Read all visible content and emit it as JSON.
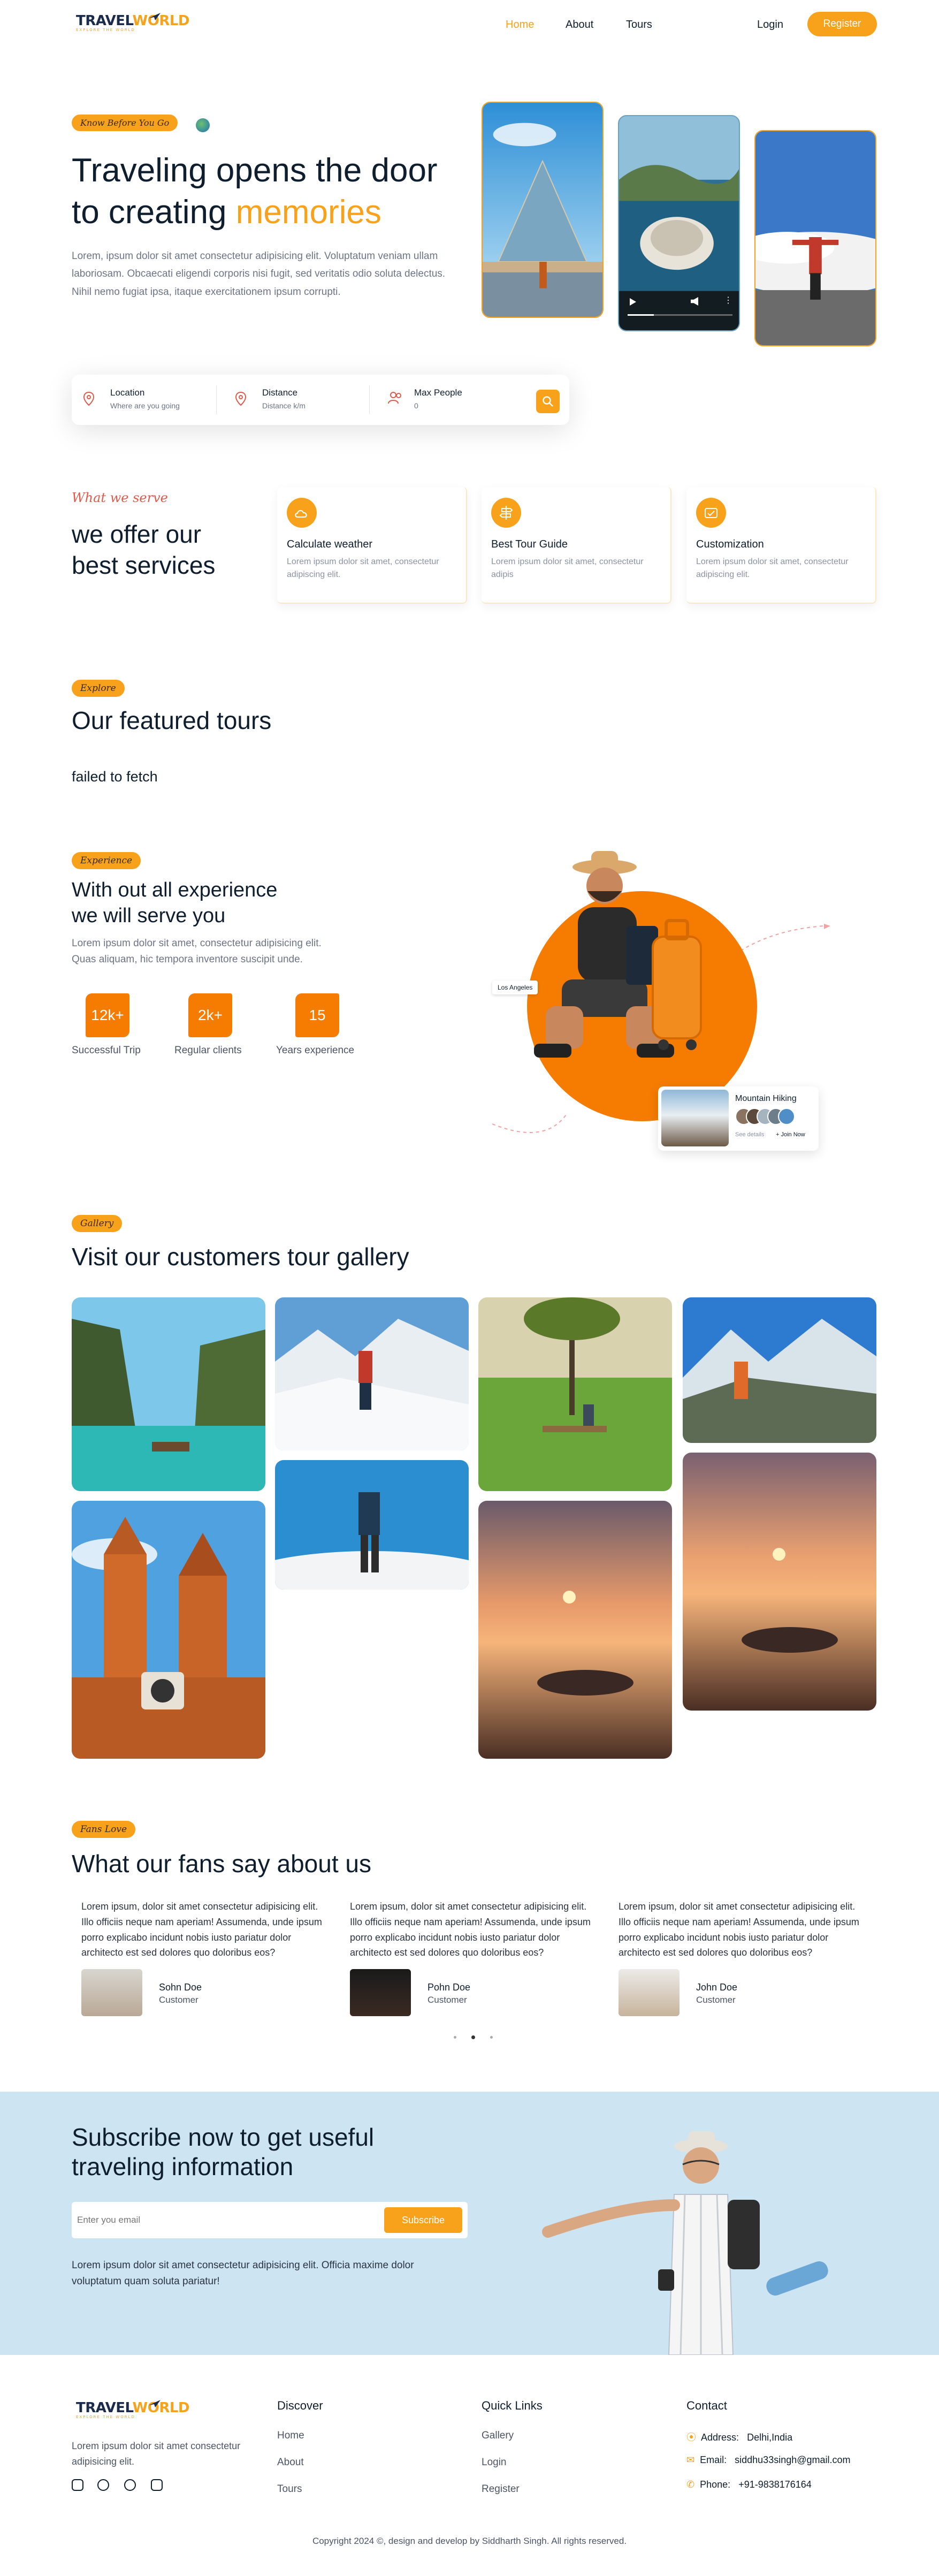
{
  "nav": {
    "logo_part1": "TRAVEL",
    "logo_part2": "WORLD",
    "logo_tagline": "EXPLORE THE WORLD",
    "links": [
      "Home",
      "About",
      "Tours"
    ],
    "login": "Login",
    "register": "Register"
  },
  "hero": {
    "pill": "Know Before You Go",
    "title_line1": "Traveling opens the door",
    "title_line2_prefix": "to creating ",
    "title_highlight": "memories",
    "paragraph": "Lorem, ipsum dolor sit amet consectetur adipisicing elit. Voluptatum veniam ullam laboriosam. Obcaecati eligendi corporis nisi fugit, sed veritatis odio soluta delectus. Nihil nemo fugiat ipsa, itaque exercitationem ipsum corrupti."
  },
  "search": {
    "fields": [
      {
        "label": "Location",
        "placeholder": "Where are you going",
        "icon": "location-pin-icon"
      },
      {
        "label": "Distance",
        "placeholder": "Distance k/m",
        "icon": "location-pin-icon"
      },
      {
        "label": "Max People",
        "placeholder": "0",
        "icon": "people-icon"
      }
    ]
  },
  "services": {
    "pill": "What we serve",
    "title_line1": "we offer our",
    "title_line2": "best services",
    "cards": [
      {
        "title": "Calculate weather",
        "desc": "Lorem ipsum dolor sit amet, consectetur adipiscing elit.",
        "icon": "weather-icon"
      },
      {
        "title": "Best Tour Guide",
        "desc": "Lorem ipsum dolor sit amet, consectetur adipis",
        "icon": "guide-icon"
      },
      {
        "title": "Customization",
        "desc": "Lorem ipsum dolor sit amet, consectetur adipiscing elit.",
        "icon": "customization-icon"
      }
    ]
  },
  "featured": {
    "pill": "Explore",
    "title": "Our featured tours",
    "status": "failed to fetch"
  },
  "experience": {
    "pill": "Experience",
    "title_line1": "With out all experience",
    "title_line2": "we will serve you",
    "paragraph_line1": "Lorem ipsum dolor sit amet, consectetur adipisicing elit.",
    "paragraph_line2": "Quas aliquam, hic tempora inventore suscipit unde.",
    "stats": [
      {
        "value": "12k+",
        "label": "Successful Trip"
      },
      {
        "value": "2k+",
        "label": "Regular clients"
      },
      {
        "value": "15",
        "label": "Years experience"
      }
    ],
    "location_tag": "Los Angeles",
    "card_title": "Mountain Hiking",
    "card_details": "See details",
    "card_join": "+ Join Now"
  },
  "gallery": {
    "pill": "Gallery",
    "title": "Visit our customers tour gallery"
  },
  "fans": {
    "pill": "Fans Love",
    "title": "What our fans say about us",
    "items": [
      {
        "text": "Lorem ipsum, dolor sit amet consectetur adipisicing elit. Illo officiis neque nam aperiam! Assumenda, unde ipsum porro explicabo incidunt nobis iusto pariatur dolor architecto est sed dolores quo doloribus eos?",
        "name": "Sohn Doe",
        "role": "Customer"
      },
      {
        "text": "Lorem ipsum, dolor sit amet consectetur adipisicing elit. Illo officiis neque nam aperiam! Assumenda, unde ipsum porro explicabo incidunt nobis iusto pariatur dolor architecto est sed dolores quo doloribus eos?",
        "name": "Pohn Doe",
        "role": "Customer"
      },
      {
        "text": "Lorem ipsum, dolor sit amet consectetur adipisicing elit. Illo officiis neque nam aperiam! Assumenda, unde ipsum porro explicabo incidunt nobis iusto pariatur dolor architecto est sed dolores quo doloribus eos?",
        "name": "John Doe",
        "role": "Customer"
      }
    ]
  },
  "subscribe": {
    "title_line1": "Subscribe now to get useful",
    "title_line2": "traveling information",
    "placeholder": "Enter you email",
    "button": "Subscribe",
    "paragraph_line1": "Lorem ipsum dolor sit amet consectetur adipisicing elit. Officia maxime dolor",
    "paragraph_line2": "voluptatum quam soluta pariatur!"
  },
  "footer": {
    "about": "Lorem ipsum dolor sit amet consectetur adipisicing elit.",
    "discover": {
      "title": "Discover",
      "links": [
        "Home",
        "About",
        "Tours"
      ]
    },
    "quick": {
      "title": "Quick Links",
      "links": [
        "Gallery",
        "Login",
        "Register"
      ]
    },
    "contact": {
      "title": "Contact",
      "address_label": "Address:",
      "address": "Delhi,India",
      "email_label": "Email:",
      "email": "siddhu33singh@gmail.com",
      "phone_label": "Phone:",
      "phone": "+91-9838176164"
    },
    "copyright": "Copyright 2024 ©, design and develop by Siddharth Singh. All rights reserved."
  },
  "colors": {
    "accent": "#f7a21a",
    "subscribe_bg": "#cde4f2",
    "dark": "#0f1e2e"
  }
}
